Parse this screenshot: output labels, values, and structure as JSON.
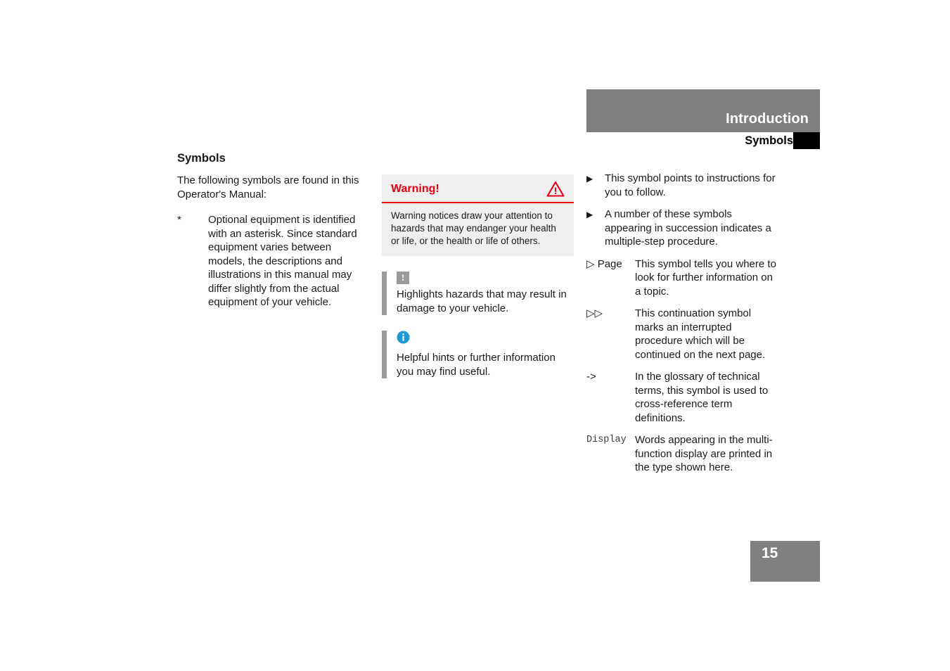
{
  "header": {
    "title": "Introduction",
    "subtitle": "Symbols"
  },
  "page": {
    "number": "15"
  },
  "left_column": {
    "section_title": "Symbols",
    "intro": "The following symbols are found in this Operator's Manual:",
    "definitions": [
      {
        "marker": "*",
        "text": "Optional equipment is identified with an asterisk. Since standard equipment varies between models, the descriptions and illustrations in this manual may differ slightly from the actual equipment of your vehicle."
      }
    ]
  },
  "middle_column": {
    "warning_box": {
      "label": "Warning!",
      "icon": "warning-triangle-icon",
      "accent_color": "#e60012",
      "background_color": "#efefef",
      "body": "Warning notices draw your attention to hazards that may endanger your health or life, or the health or life of others."
    },
    "callouts": [
      {
        "icon": "exclamation-square-icon",
        "icon_color": "#9a9a9a",
        "text": "Highlights hazards that may result in damage to your vehicle."
      },
      {
        "icon": "info-circle-icon",
        "icon_color": "#1e9ad6",
        "text": "Helpful hints or further information you may find useful."
      }
    ]
  },
  "right_column": {
    "symbols": [
      {
        "marker": "▶",
        "marker_type": "bullet",
        "text": "This symbol points to instructions for you to follow."
      },
      {
        "marker": "▶",
        "marker_type": "bullet",
        "text": "A number of these symbols appearing in succession indicates a multiple-step procedure."
      },
      {
        "marker": "▷ Page",
        "marker_type": "labelled",
        "text": "This symbol tells you where to look for further information on a topic."
      },
      {
        "marker": "▷▷",
        "marker_type": "labelled",
        "text": "This continuation symbol marks an interrupted procedure which will be continued on the next page."
      },
      {
        "marker": "->",
        "marker_type": "labelled",
        "text": "In the glossary of technical terms, this symbol is used to cross-reference term definitions."
      },
      {
        "marker": "Display",
        "marker_type": "labelled-mono",
        "text": "Words appearing in the multi-function display are printed in the type shown here."
      }
    ]
  }
}
